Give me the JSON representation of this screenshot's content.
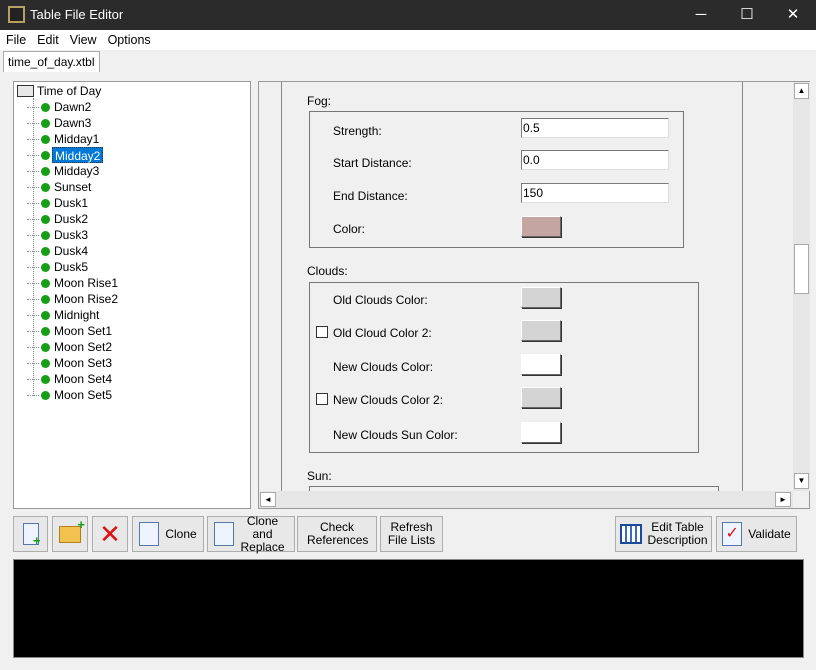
{
  "window": {
    "title": "Table File Editor",
    "minimize": "─",
    "maximize": "☐",
    "close": "✕"
  },
  "menu": [
    "File",
    "Edit",
    "View",
    "Options"
  ],
  "tab": "time_of_day.xtbl",
  "tree": {
    "root": "Time of Day",
    "items": [
      "Dawn2",
      "Dawn3",
      "Midday1",
      "Midday2",
      "Midday3",
      "Sunset",
      "Dusk1",
      "Dusk2",
      "Dusk3",
      "Dusk4",
      "Dusk5",
      "Moon Rise1",
      "Moon Rise2",
      "Midnight",
      "Moon Set1",
      "Moon Set2",
      "Moon Set3",
      "Moon Set4",
      "Moon Set5"
    ],
    "selected": "Midday2"
  },
  "fog": {
    "label": "Fog:",
    "strength_label": "Strength:",
    "strength": "0.5",
    "start_label": "Start Distance:",
    "start": "0.0",
    "end_label": "End Distance:",
    "end": "150",
    "color_label": "Color:",
    "color": "#c4a5a1"
  },
  "clouds": {
    "label": "Clouds:",
    "old_color_label": "Old Clouds Color:",
    "old_color": "#d4d4d4",
    "old_color2_label": "Old Cloud Color 2:",
    "old_color2": "#d4d4d4",
    "old_color2_checked": false,
    "new_color_label": "New Clouds Color:",
    "new_color": "#ffffff",
    "new_color2_label": "New Clouds Color 2:",
    "new_color2": "#d4d4d4",
    "new_color2_checked": false,
    "sun_color_label": "New Clouds Sun Color:",
    "sun_color": "#ffffff"
  },
  "sun": {
    "label": "Sun:"
  },
  "toolbar": {
    "clone": "Clone",
    "clone_replace": "Clone and Replace",
    "check_refs": "Check References",
    "refresh": "Refresh File Lists",
    "edit_desc": "Edit Table Description",
    "validate": "Validate"
  }
}
